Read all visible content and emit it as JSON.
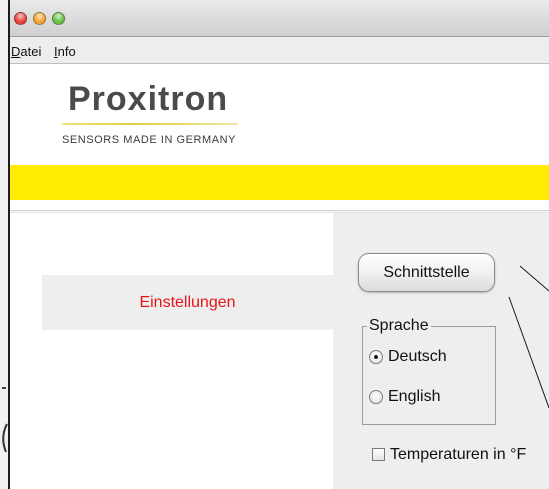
{
  "window": {
    "controls": [
      {
        "icon": "close-icon",
        "color": "#e8473f"
      },
      {
        "icon": "minimize-icon",
        "color": "#f3a73a"
      },
      {
        "icon": "zoom-icon",
        "color": "#6ec14a"
      }
    ]
  },
  "menu": {
    "items": [
      {
        "label": "Datei"
      },
      {
        "label": "Info"
      }
    ]
  },
  "header": {
    "logo": "Proxitron",
    "tagline": "SENSORS MADE IN GERMANY"
  },
  "nav": {
    "items": [
      {
        "label": "Einstellungen",
        "selected": true
      }
    ]
  },
  "settings": {
    "interface_button": {
      "label": "Schnittstelle"
    },
    "language": {
      "legend": "Sprache",
      "options": [
        {
          "label": "Deutsch",
          "selected": true
        },
        {
          "label": "English",
          "selected": false
        }
      ]
    },
    "fahrenheit": {
      "label": "Temperaturen in °F",
      "checked": false
    }
  },
  "colors": {
    "brand_yellow": "#ffec00",
    "nav_selected_text": "#e8141b",
    "panel_background": "#eeeeee",
    "logo_text": "#4b4b4b"
  }
}
